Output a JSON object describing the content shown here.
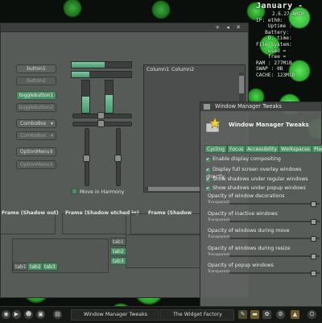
{
  "conky": {
    "date": "January -",
    "kernel": "2.6.27-ARCH",
    "lines": [
      "IP: eth0:",
      "    Uptime :",
      "   Battery:",
      "    B. time:",
      "File System:",
      "    used =",
      "    free =",
      "RAM : 277MiB",
      "SWAP : 0B",
      "CACHE: 123MiB"
    ]
  },
  "widget_factory": {
    "title_buttons": "+ ◂ ✕",
    "buttons": {
      "button1": "button1",
      "button2": "button2",
      "toggle1": "togglebutton1",
      "toggle2": "togglebutton2",
      "combo1": "ComboBox",
      "combo2": "ComboBox",
      "option1": "OptionMenu",
      "option2": "OptionMenu"
    },
    "list_columns": [
      "Column1",
      "Column2"
    ],
    "move_in_harmony": "Move in Harmony",
    "move_in_harmony_checked": true,
    "progress": {
      "h1": 0.55,
      "h2": 0.3,
      "v1": 0.5,
      "v2": 0.55
    },
    "frames": {
      "shadow_out": "Frame (Shadow out)",
      "shadow_etched_in": "Frame (Shadow etched in)",
      "shadow_cut": "Frame (Shadow"
    },
    "tabs_bottom": [
      "tab1",
      "tab2",
      "tab3"
    ],
    "tabs_side": [
      "tab1",
      "tab2",
      "tab3"
    ]
  },
  "wm_tweaks": {
    "title": "Window Manager Tweaks",
    "header_title": "Window Manager Tweaks",
    "tabs": [
      "Cycling",
      "Focus",
      "Accessibility",
      "Workspaces",
      "Plac"
    ],
    "checks": [
      {
        "label": "Enable display compositing",
        "checked": true
      },
      {
        "label": "Display full screen overlay windows directly",
        "checked": true
      },
      {
        "label": "Show shadows under regular windows",
        "checked": true
      },
      {
        "label": "Show shadows under popup windows",
        "checked": true
      }
    ],
    "opacities": [
      {
        "label": "Opacity of window decorations",
        "tr": "Transparent",
        "value": 0.9
      },
      {
        "label": "Opacity of inactive windows",
        "tr": "Transparent",
        "value": 0.9
      },
      {
        "label": "Opacity of windows during move",
        "tr": "Transparent",
        "value": 0.9
      },
      {
        "label": "Opacity of windows during resize",
        "tr": "Transparent",
        "value": 0.9
      },
      {
        "label": "Opacity of popup windows",
        "tr": "Transparent",
        "value": 0.9
      }
    ]
  },
  "taskbar": {
    "tasks": [
      {
        "label": "Window Manager Tweaks",
        "active": false
      },
      {
        "label": "The Widget Factory",
        "active": false
      }
    ]
  }
}
